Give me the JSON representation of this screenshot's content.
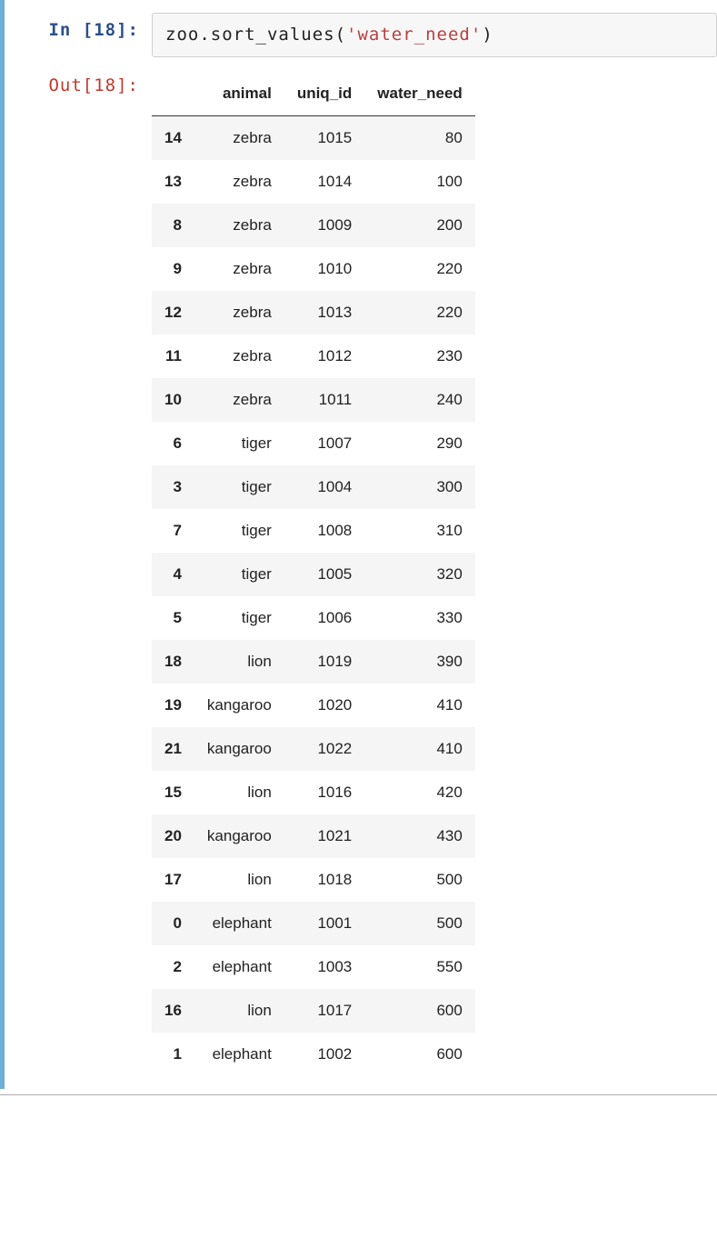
{
  "cell": {
    "in_prompt": "In [18]:",
    "out_prompt": "Out[18]:",
    "code": {
      "base": "zoo.sort_values(",
      "string": "'water_need'",
      "close": ")"
    }
  },
  "table": {
    "columns": [
      "animal",
      "uniq_id",
      "water_need"
    ],
    "rows": [
      {
        "index": "14",
        "animal": "zebra",
        "uniq_id": "1015",
        "water_need": "80"
      },
      {
        "index": "13",
        "animal": "zebra",
        "uniq_id": "1014",
        "water_need": "100"
      },
      {
        "index": "8",
        "animal": "zebra",
        "uniq_id": "1009",
        "water_need": "200"
      },
      {
        "index": "9",
        "animal": "zebra",
        "uniq_id": "1010",
        "water_need": "220"
      },
      {
        "index": "12",
        "animal": "zebra",
        "uniq_id": "1013",
        "water_need": "220"
      },
      {
        "index": "11",
        "animal": "zebra",
        "uniq_id": "1012",
        "water_need": "230"
      },
      {
        "index": "10",
        "animal": "zebra",
        "uniq_id": "1011",
        "water_need": "240"
      },
      {
        "index": "6",
        "animal": "tiger",
        "uniq_id": "1007",
        "water_need": "290"
      },
      {
        "index": "3",
        "animal": "tiger",
        "uniq_id": "1004",
        "water_need": "300"
      },
      {
        "index": "7",
        "animal": "tiger",
        "uniq_id": "1008",
        "water_need": "310"
      },
      {
        "index": "4",
        "animal": "tiger",
        "uniq_id": "1005",
        "water_need": "320"
      },
      {
        "index": "5",
        "animal": "tiger",
        "uniq_id": "1006",
        "water_need": "330"
      },
      {
        "index": "18",
        "animal": "lion",
        "uniq_id": "1019",
        "water_need": "390"
      },
      {
        "index": "19",
        "animal": "kangaroo",
        "uniq_id": "1020",
        "water_need": "410"
      },
      {
        "index": "21",
        "animal": "kangaroo",
        "uniq_id": "1022",
        "water_need": "410"
      },
      {
        "index": "15",
        "animal": "lion",
        "uniq_id": "1016",
        "water_need": "420"
      },
      {
        "index": "20",
        "animal": "kangaroo",
        "uniq_id": "1021",
        "water_need": "430"
      },
      {
        "index": "17",
        "animal": "lion",
        "uniq_id": "1018",
        "water_need": "500"
      },
      {
        "index": "0",
        "animal": "elephant",
        "uniq_id": "1001",
        "water_need": "500"
      },
      {
        "index": "2",
        "animal": "elephant",
        "uniq_id": "1003",
        "water_need": "550"
      },
      {
        "index": "16",
        "animal": "lion",
        "uniq_id": "1017",
        "water_need": "600"
      },
      {
        "index": "1",
        "animal": "elephant",
        "uniq_id": "1002",
        "water_need": "600"
      }
    ]
  }
}
